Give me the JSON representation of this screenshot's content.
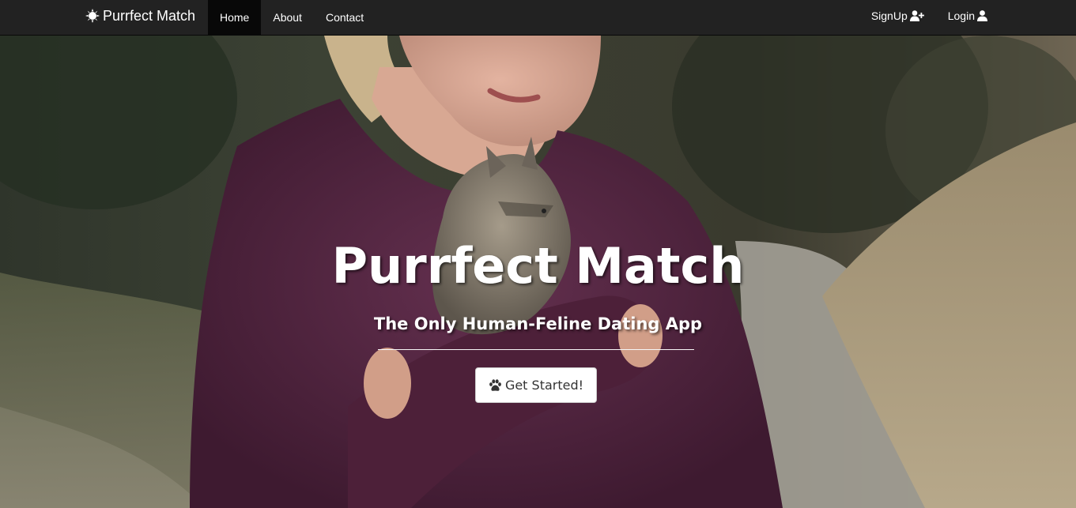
{
  "navbar": {
    "brand": {
      "label": "Purrfect Match",
      "icon": "sun-icon"
    },
    "left_items": [
      {
        "label": "Home",
        "active": true
      },
      {
        "label": "About",
        "active": false
      },
      {
        "label": "Contact",
        "active": false
      }
    ],
    "right_items": [
      {
        "label": "SignUp",
        "icon": "user-plus-icon"
      },
      {
        "label": "Login",
        "icon": "user-icon"
      }
    ]
  },
  "hero": {
    "title": "Purrfect Match",
    "subtitle": "The Only Human-Feline Dating App",
    "cta": {
      "label": "Get Started!",
      "icon": "paw-icon"
    },
    "background_image": "woman-holding-kitten-photo"
  },
  "colors": {
    "navbar_bg": "#222222",
    "navbar_active_bg": "#080808",
    "navbar_text": "#ffffff",
    "hero_text": "#ffffff",
    "sweater": "#5a2a45"
  }
}
